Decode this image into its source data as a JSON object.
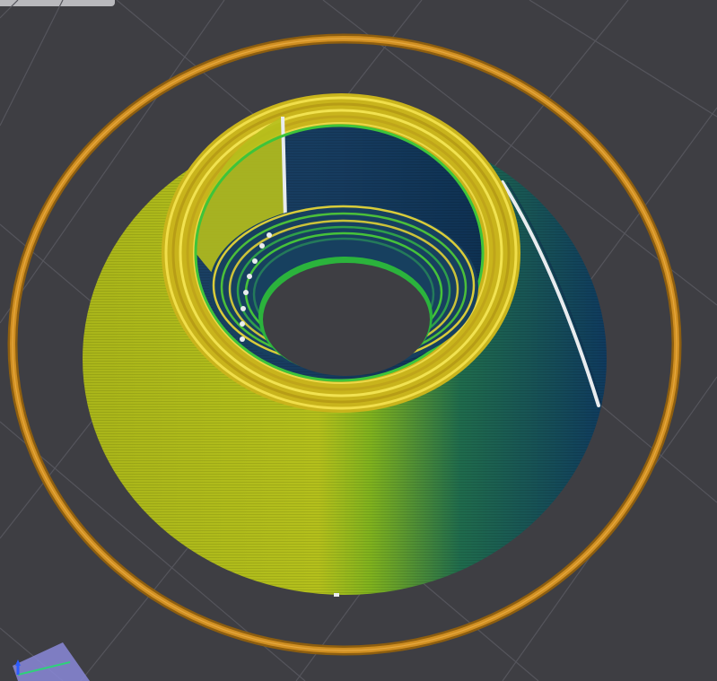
{
  "viewport": {
    "background": "#3e3e43",
    "grid_color": "#55555c"
  },
  "model": {
    "shape": "truncated-cone-shell",
    "colors": {
      "skirt": "#c98a1e",
      "outer_wall_light": "#b8c41c",
      "outer_wall_dark": "#0f3a5e",
      "top_rim": "#e2d23a",
      "inner_wall": "#173f62",
      "inner_ring": "#44c73a",
      "seam": "#e9ecef"
    }
  },
  "gizmo": {
    "icon": "axis-gizmo-icon",
    "colors": {
      "x": "#2fd17a",
      "y": "#2c5cff",
      "plane": "#8a88d8"
    }
  }
}
